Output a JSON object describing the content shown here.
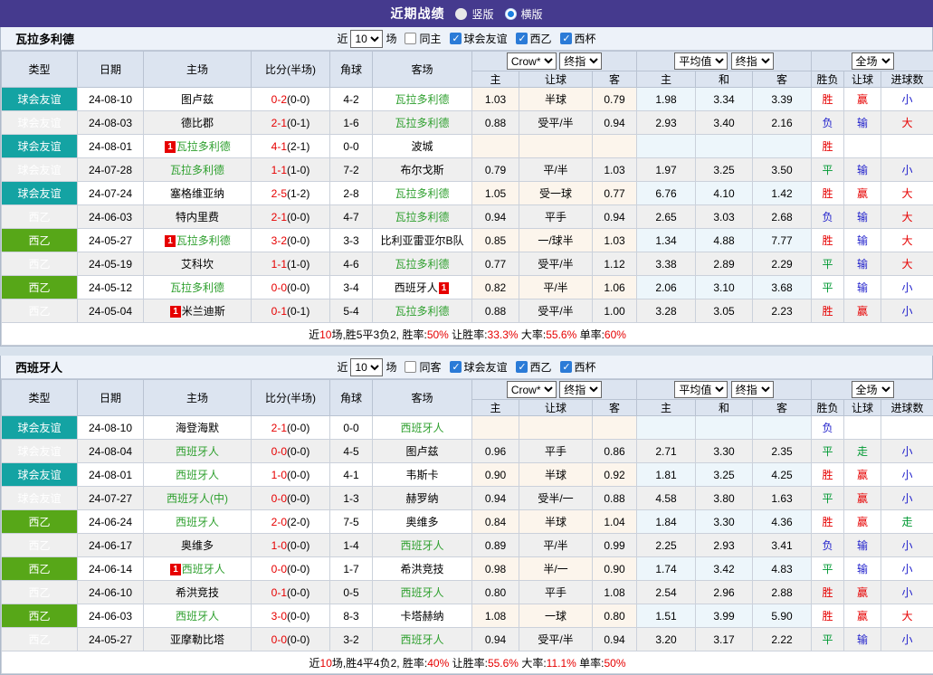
{
  "title_bar": {
    "title": "近期战绩",
    "vertical_label": "竖版",
    "horizontal_label": "横版",
    "selected": "横版"
  },
  "filter_labels": {
    "near": "近",
    "games": "10",
    "games_suffix": "场",
    "leagues": [
      "球会友谊",
      "西乙",
      "西杯"
    ]
  },
  "header": {
    "type": "类型",
    "date": "日期",
    "home": "主场",
    "score": "比分(半场)",
    "corner": "角球",
    "away": "客场",
    "odds_source": "Crow*",
    "odds_final": "终指",
    "avg_source": "平均值",
    "avg_final": "终指",
    "scope": "全场",
    "sub": [
      "主",
      "让球",
      "客",
      "主",
      "和",
      "客",
      "胜负",
      "让球",
      "进球数"
    ]
  },
  "colors": {
    "accent_purple": "#453A8E",
    "friendly_teal": "#14A3A3",
    "league_green": "#57A718",
    "team_green": "#2FA02F",
    "win_red": "#E60000",
    "lose_blue": "#2222CC",
    "draw_green": "#009933"
  },
  "sections": [
    {
      "team": "瓦拉多利德",
      "same_label": "同主",
      "same_checked": false,
      "league_checked": [
        true,
        true,
        true
      ],
      "rows": [
        {
          "league": "frd",
          "type": "球会友谊",
          "date": "24-08-10",
          "home": {
            "text": "图卢兹"
          },
          "score": "0-2",
          "half": "(0-0)",
          "corner": "4-2",
          "away": {
            "text": "瓦拉多利德",
            "green": true
          },
          "crow": [
            "1.03",
            "半球",
            "0.79"
          ],
          "avg": [
            "1.98",
            "3.34",
            "3.39"
          ],
          "res": [
            [
              "胜",
              "red"
            ],
            [
              "赢",
              "red"
            ],
            [
              "小",
              "blue"
            ]
          ]
        },
        {
          "league": "frd",
          "type": "球会友谊",
          "date": "24-08-03",
          "home": {
            "text": "德比郡"
          },
          "score": "2-1",
          "half": "(0-1)",
          "corner": "1-6",
          "away": {
            "text": "瓦拉多利德",
            "green": true
          },
          "crow": [
            "0.88",
            "受平/半",
            "0.94"
          ],
          "avg": [
            "2.93",
            "3.40",
            "2.16"
          ],
          "res": [
            [
              "负",
              "blue"
            ],
            [
              "输",
              "blue"
            ],
            [
              "大",
              "red"
            ]
          ]
        },
        {
          "league": "frd",
          "type": "球会友谊",
          "date": "24-08-01",
          "home": {
            "text": "瓦拉多利德",
            "green": true,
            "badge": "1",
            "badge_pos": "before"
          },
          "score": "4-1",
          "half": "(2-1)",
          "corner": "0-0",
          "away": {
            "text": "波城"
          },
          "crow": [
            "",
            "",
            ""
          ],
          "avg": [
            "",
            "",
            ""
          ],
          "res": [
            [
              "胜",
              "red"
            ],
            [
              "",
              ""
            ],
            [
              "",
              ""
            ]
          ]
        },
        {
          "league": "frd",
          "type": "球会友谊",
          "date": "24-07-28",
          "home": {
            "text": "瓦拉多利德",
            "green": true
          },
          "score": "1-1",
          "half": "(1-0)",
          "corner": "7-2",
          "away": {
            "text": "布尔戈斯"
          },
          "crow": [
            "0.79",
            "平/半",
            "1.03"
          ],
          "avg": [
            "1.97",
            "3.25",
            "3.50"
          ],
          "res": [
            [
              "平",
              "dgreen"
            ],
            [
              "输",
              "blue"
            ],
            [
              "小",
              "blue"
            ]
          ]
        },
        {
          "league": "frd",
          "type": "球会友谊",
          "date": "24-07-24",
          "home": {
            "text": "塞格维亚纳"
          },
          "score": "2-5",
          "half": "(1-2)",
          "corner": "2-8",
          "away": {
            "text": "瓦拉多利德",
            "green": true
          },
          "crow": [
            "1.05",
            "受一球",
            "0.77"
          ],
          "avg": [
            "6.76",
            "4.10",
            "1.42"
          ],
          "res": [
            [
              "胜",
              "red"
            ],
            [
              "赢",
              "red"
            ],
            [
              "大",
              "red"
            ]
          ]
        },
        {
          "league": "sec",
          "type": "西乙",
          "date": "24-06-03",
          "home": {
            "text": "特内里费"
          },
          "score": "2-1",
          "half": "(0-0)",
          "corner": "4-7",
          "away": {
            "text": "瓦拉多利德",
            "green": true
          },
          "crow": [
            "0.94",
            "平手",
            "0.94"
          ],
          "avg": [
            "2.65",
            "3.03",
            "2.68"
          ],
          "res": [
            [
              "负",
              "blue"
            ],
            [
              "输",
              "blue"
            ],
            [
              "大",
              "red"
            ]
          ]
        },
        {
          "league": "sec",
          "type": "西乙",
          "date": "24-05-27",
          "home": {
            "text": "瓦拉多利德",
            "green": true,
            "badge": "1",
            "badge_pos": "before"
          },
          "score": "3-2",
          "half": "(0-0)",
          "corner": "3-3",
          "away": {
            "text": "比利亚雷亚尔B队"
          },
          "crow": [
            "0.85",
            "一/球半",
            "1.03"
          ],
          "avg": [
            "1.34",
            "4.88",
            "7.77"
          ],
          "res": [
            [
              "胜",
              "red"
            ],
            [
              "输",
              "blue"
            ],
            [
              "大",
              "red"
            ]
          ]
        },
        {
          "league": "sec",
          "type": "西乙",
          "date": "24-05-19",
          "home": {
            "text": "艾科坎"
          },
          "score": "1-1",
          "half": "(1-0)",
          "corner": "4-6",
          "away": {
            "text": "瓦拉多利德",
            "green": true
          },
          "crow": [
            "0.77",
            "受平/半",
            "1.12"
          ],
          "avg": [
            "3.38",
            "2.89",
            "2.29"
          ],
          "res": [
            [
              "平",
              "dgreen"
            ],
            [
              "输",
              "blue"
            ],
            [
              "大",
              "red"
            ]
          ]
        },
        {
          "league": "sec",
          "type": "西乙",
          "date": "24-05-12",
          "home": {
            "text": "瓦拉多利德",
            "green": true
          },
          "score": "0-0",
          "half": "(0-0)",
          "corner": "3-4",
          "away": {
            "text": "西班牙人",
            "badge": "1",
            "badge_pos": "after"
          },
          "crow": [
            "0.82",
            "平/半",
            "1.06"
          ],
          "avg": [
            "2.06",
            "3.10",
            "3.68"
          ],
          "res": [
            [
              "平",
              "dgreen"
            ],
            [
              "输",
              "blue"
            ],
            [
              "小",
              "blue"
            ]
          ]
        },
        {
          "league": "sec",
          "type": "西乙",
          "date": "24-05-04",
          "home": {
            "text": "米兰迪斯",
            "badge": "1",
            "badge_pos": "before"
          },
          "score": "0-1",
          "half": "(0-1)",
          "corner": "5-4",
          "away": {
            "text": "瓦拉多利德",
            "green": true
          },
          "crow": [
            "0.88",
            "受平/半",
            "1.00"
          ],
          "avg": [
            "3.28",
            "3.05",
            "2.23"
          ],
          "res": [
            [
              "胜",
              "red"
            ],
            [
              "赢",
              "red"
            ],
            [
              "小",
              "blue"
            ]
          ]
        }
      ],
      "summary": [
        [
          "近",
          "b"
        ],
        [
          "10",
          "r"
        ],
        [
          "场,胜5平3负2, 胜率:",
          "b"
        ],
        [
          "50%",
          "r"
        ],
        [
          " 让胜率:",
          "b"
        ],
        [
          "33.3%",
          "r"
        ],
        [
          " 大率:",
          "b"
        ],
        [
          "55.6%",
          "r"
        ],
        [
          " 单率:",
          "b"
        ],
        [
          "60%",
          "r"
        ]
      ]
    },
    {
      "team": "西班牙人",
      "same_label": "同客",
      "same_checked": false,
      "league_checked": [
        true,
        true,
        true
      ],
      "rows": [
        {
          "league": "frd",
          "type": "球会友谊",
          "date": "24-08-10",
          "home": {
            "text": "海登海默"
          },
          "score": "2-1",
          "half": "(0-0)",
          "corner": "0-0",
          "away": {
            "text": "西班牙人",
            "green": true
          },
          "crow": [
            "",
            "",
            ""
          ],
          "avg": [
            "",
            "",
            ""
          ],
          "res": [
            [
              "负",
              "blue"
            ],
            [
              "",
              ""
            ],
            [
              "",
              ""
            ]
          ]
        },
        {
          "league": "frd",
          "type": "球会友谊",
          "date": "24-08-04",
          "home": {
            "text": "西班牙人",
            "green": true
          },
          "score": "0-0",
          "half": "(0-0)",
          "corner": "4-5",
          "away": {
            "text": "图卢兹"
          },
          "crow": [
            "0.96",
            "平手",
            "0.86"
          ],
          "avg": [
            "2.71",
            "3.30",
            "2.35"
          ],
          "res": [
            [
              "平",
              "dgreen"
            ],
            [
              "走",
              "dgreen"
            ],
            [
              "小",
              "blue"
            ]
          ]
        },
        {
          "league": "frd",
          "type": "球会友谊",
          "date": "24-08-01",
          "home": {
            "text": "西班牙人",
            "green": true
          },
          "score": "1-0",
          "half": "(0-0)",
          "corner": "4-1",
          "away": {
            "text": "韦斯卡"
          },
          "crow": [
            "0.90",
            "半球",
            "0.92"
          ],
          "avg": [
            "1.81",
            "3.25",
            "4.25"
          ],
          "res": [
            [
              "胜",
              "red"
            ],
            [
              "赢",
              "red"
            ],
            [
              "小",
              "blue"
            ]
          ]
        },
        {
          "league": "frd",
          "type": "球会友谊",
          "date": "24-07-27",
          "home": {
            "text": "西班牙人(中)",
            "green": true
          },
          "score": "0-0",
          "half": "(0-0)",
          "corner": "1-3",
          "away": {
            "text": "赫罗纳"
          },
          "crow": [
            "0.94",
            "受半/一",
            "0.88"
          ],
          "avg": [
            "4.58",
            "3.80",
            "1.63"
          ],
          "res": [
            [
              "平",
              "dgreen"
            ],
            [
              "赢",
              "red"
            ],
            [
              "小",
              "blue"
            ]
          ]
        },
        {
          "league": "sec",
          "type": "西乙",
          "date": "24-06-24",
          "home": {
            "text": "西班牙人",
            "green": true
          },
          "score": "2-0",
          "half": "(2-0)",
          "corner": "7-5",
          "away": {
            "text": "奥维多"
          },
          "crow": [
            "0.84",
            "半球",
            "1.04"
          ],
          "avg": [
            "1.84",
            "3.30",
            "4.36"
          ],
          "res": [
            [
              "胜",
              "red"
            ],
            [
              "赢",
              "red"
            ],
            [
              "走",
              "dgreen"
            ]
          ]
        },
        {
          "league": "sec",
          "type": "西乙",
          "date": "24-06-17",
          "home": {
            "text": "奥维多"
          },
          "score": "1-0",
          "half": "(0-0)",
          "corner": "1-4",
          "away": {
            "text": "西班牙人",
            "green": true
          },
          "crow": [
            "0.89",
            "平/半",
            "0.99"
          ],
          "avg": [
            "2.25",
            "2.93",
            "3.41"
          ],
          "res": [
            [
              "负",
              "blue"
            ],
            [
              "输",
              "blue"
            ],
            [
              "小",
              "blue"
            ]
          ]
        },
        {
          "league": "sec",
          "type": "西乙",
          "date": "24-06-14",
          "home": {
            "text": "西班牙人",
            "green": true,
            "badge": "1",
            "badge_pos": "before"
          },
          "score": "0-0",
          "half": "(0-0)",
          "corner": "1-7",
          "away": {
            "text": "希洪竞技"
          },
          "crow": [
            "0.98",
            "半/一",
            "0.90"
          ],
          "avg": [
            "1.74",
            "3.42",
            "4.83"
          ],
          "res": [
            [
              "平",
              "dgreen"
            ],
            [
              "输",
              "blue"
            ],
            [
              "小",
              "blue"
            ]
          ]
        },
        {
          "league": "sec",
          "type": "西乙",
          "date": "24-06-10",
          "home": {
            "text": "希洪竞技"
          },
          "score": "0-1",
          "half": "(0-0)",
          "corner": "0-5",
          "away": {
            "text": "西班牙人",
            "green": true
          },
          "crow": [
            "0.80",
            "平手",
            "1.08"
          ],
          "avg": [
            "2.54",
            "2.96",
            "2.88"
          ],
          "res": [
            [
              "胜",
              "red"
            ],
            [
              "赢",
              "red"
            ],
            [
              "小",
              "blue"
            ]
          ]
        },
        {
          "league": "sec",
          "type": "西乙",
          "date": "24-06-03",
          "home": {
            "text": "西班牙人",
            "green": true
          },
          "score": "3-0",
          "half": "(0-0)",
          "corner": "8-3",
          "away": {
            "text": "卡塔赫纳"
          },
          "crow": [
            "1.08",
            "一球",
            "0.80"
          ],
          "avg": [
            "1.51",
            "3.99",
            "5.90"
          ],
          "res": [
            [
              "胜",
              "red"
            ],
            [
              "赢",
              "red"
            ],
            [
              "大",
              "red"
            ]
          ]
        },
        {
          "league": "sec",
          "type": "西乙",
          "date": "24-05-27",
          "home": {
            "text": "亚摩勒比塔"
          },
          "score": "0-0",
          "half": "(0-0)",
          "corner": "3-2",
          "away": {
            "text": "西班牙人",
            "green": true
          },
          "crow": [
            "0.94",
            "受平/半",
            "0.94"
          ],
          "avg": [
            "3.20",
            "3.17",
            "2.22"
          ],
          "res": [
            [
              "平",
              "dgreen"
            ],
            [
              "输",
              "blue"
            ],
            [
              "小",
              "blue"
            ]
          ]
        }
      ],
      "summary": [
        [
          "近",
          "b"
        ],
        [
          "10",
          "r"
        ],
        [
          "场,胜4平4负2, 胜率:",
          "b"
        ],
        [
          "40%",
          "r"
        ],
        [
          " 让胜率:",
          "b"
        ],
        [
          "55.6%",
          "r"
        ],
        [
          " 大率:",
          "b"
        ],
        [
          "11.1%",
          "r"
        ],
        [
          " 单率:",
          "b"
        ],
        [
          "50%",
          "r"
        ]
      ]
    }
  ]
}
